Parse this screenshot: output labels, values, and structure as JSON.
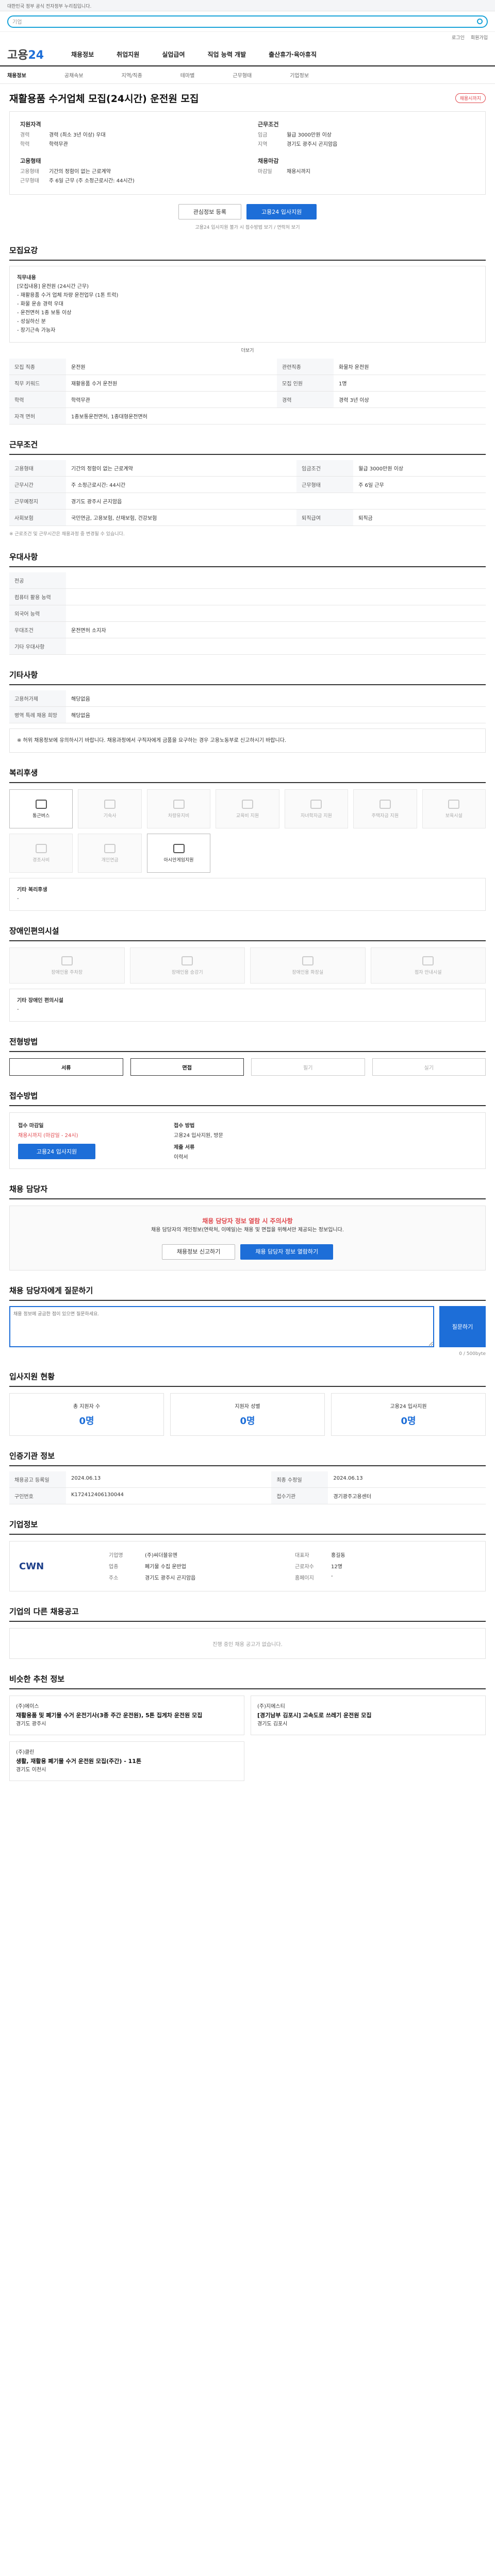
{
  "gov": "대한민국 정부 공식 전자정부 누리집입니다.",
  "search": {
    "placeholder": "기업"
  },
  "links": [
    "로그인",
    "회원가입"
  ],
  "logo": {
    "a": "고용",
    "b": "24"
  },
  "gnb": [
    "채용정보",
    "취업지원",
    "실업급여",
    "직업 능력 개발",
    "출산휴가·육아휴직"
  ],
  "subnav": [
    "채용정보",
    "공채속보",
    "지역/직종",
    "테마별",
    "근무형태",
    "기업정보"
  ],
  "title": "재활용품 수거업체 모집(24시간) 운전원 모집",
  "status": "채용시까지",
  "summary": {
    "h1": "지원자격",
    "r1": [
      [
        "경력",
        "경력 (최소 3년 이상) 우대"
      ],
      [
        "학력",
        "학력무관"
      ]
    ],
    "h2": "근무조건",
    "r2": [
      [
        "임금",
        "월급 3000만원 이상"
      ],
      [
        "지역",
        "경기도 광주시 곤지암읍"
      ]
    ],
    "h3": "고용형태",
    "r3": [
      [
        "고용형태",
        "기간의 정함이 없는 근로계약"
      ],
      [
        "근무형태",
        "주 6일 근무 (주 소정근로시간: 44시간)"
      ]
    ],
    "h4": "채용마감",
    "r4": [
      [
        "마감일",
        "채용시까지"
      ]
    ]
  },
  "buttons": {
    "save": "관심정보 등록",
    "apply": "고용24 입사지원"
  },
  "apply_note": "고용24 입사지원 불가 시 접수방법 보기 / 연락처 보기",
  "detail": {
    "h": "모집요강",
    "job_h": "직무내용",
    "lines": [
      "[모집내용] 운전원 (24시간 근무)",
      "- 재활용품 수거 업체 차량 운전업무 (1톤 트럭)",
      "- 화물 운송 경력 우대",
      "- 운전면허 1종 보통 이상",
      "- 성실하신 분",
      "- 장기근속 가능자"
    ],
    "more": "더보기"
  },
  "recruit": [
    [
      "모집 직종",
      "운전원",
      "관련직종",
      "화물차 운전원"
    ],
    [
      "직무 키워드",
      "재활용품 수거 운전원",
      "모집 인원",
      "1명"
    ],
    [
      "학력",
      "학력무관",
      "경력",
      "경력 3년 이상"
    ],
    [
      "자격 면허",
      "1종보통운전면허, 1종대형운전면허",
      "",
      ""
    ]
  ],
  "cond": {
    "h": "근무조건",
    "rows": [
      [
        "고용형태",
        "기간의 정함이 없는 근로계약",
        "임금조건",
        "월급 3000만원 이상"
      ],
      [
        "근무시간",
        "주 소정근로시간: 44시간",
        "근무형태",
        "주 6일 근무"
      ],
      [
        "근무예정지",
        "경기도 광주시 곤지암읍",
        "",
        ""
      ],
      [
        "사회보험",
        "국민연금, 고용보험, 산재보험, 건강보험",
        "퇴직급여",
        "퇴직금"
      ]
    ],
    "note": "※ 근로조건 및 근무시간은 채용과정 중 변경될 수 있습니다."
  },
  "prefer": {
    "h": "우대사항",
    "rows": [
      [
        "전공",
        ""
      ],
      [
        "컴퓨터 활용 능력",
        ""
      ],
      [
        "외국어 능력",
        ""
      ],
      [
        "우대조건",
        "운전면허 소지자"
      ],
      [
        "기타 우대사항",
        ""
      ]
    ]
  },
  "other": {
    "h": "기타사항",
    "rows": [
      [
        "고용허가제",
        "해당없음"
      ],
      [
        "병역 특례 채용 희망",
        "해당없음"
      ]
    ],
    "notice": "※ 허위 채용정보에 유의하시기 바랍니다. 채용과정에서 구직자에게 금품을 요구하는 경우 고용노동부로 신고하시기 바랍니다."
  },
  "welfare": {
    "h": "복리후생",
    "items": [
      "통근버스",
      "기숙사",
      "차량유지비",
      "교육비 지원",
      "자녀학자금 지원",
      "주택자금 지원",
      "보육시설",
      "경조사비",
      "개인연금",
      "아시안게임지원"
    ],
    "on": [
      0,
      9
    ],
    "etc_h": "기타 복리후생",
    "etc": "-"
  },
  "disabled": {
    "h": "장애인편의시설",
    "items": [
      "장애인용 주차장",
      "장애인용 승강기",
      "장애인용 화장실",
      "점자 안내시설"
    ],
    "etc_h": "기타 장애인 편의시설",
    "etc": "-"
  },
  "process": {
    "h": "전형방법",
    "steps": [
      "서류",
      "면접",
      "필기",
      "실기"
    ],
    "on": [
      0,
      1
    ]
  },
  "applyinfo": {
    "h": "접수방법",
    "rows": [
      [
        "접수 마감일",
        "채용시까지 (마감일 - 24시)"
      ],
      [
        "접수 방법",
        "고용24 입사지원, 방문"
      ],
      [
        "제출 서류",
        "이력서"
      ]
    ],
    "btn": "고용24 입사지원"
  },
  "manager": {
    "h": "채용 담당자",
    "warn": "채용 담당자 정보 열람 시 주의사항",
    "text": "채용 담당자의 개인정보(연락처, 이메일)는 채용 및 면접을 위해서만 제공되는 정보입니다.",
    "btn1": "채용정보 신고하기",
    "btn2": "채용 담당자 정보 열람하기"
  },
  "qa": {
    "h": "채용 담당자에게 질문하기",
    "placeholder": "채용 정보에 궁금한 점이 있으면 질문하세요.",
    "send": "질문하기",
    "count": "0 / 500byte"
  },
  "stats": {
    "h": "입사지원 현황",
    "items": [
      [
        "총 지원자 수",
        "0명"
      ],
      [
        "지원자 성별",
        "0명"
      ],
      [
        "고용24 입사지원",
        "0명"
      ]
    ]
  },
  "reg": {
    "h": "인증기관 정보",
    "rows": [
      [
        "채용공고 등록일",
        "2024.06.13",
        "최종 수정일",
        "2024.06.13"
      ],
      [
        "구인번호",
        "K172412406130044",
        "접수기관",
        "경기광주고용센터"
      ]
    ]
  },
  "company": {
    "h": "기업정보",
    "logo": "CWN",
    "rows": [
      [
        "기업명",
        "(주)씨더블유엔",
        "대표자",
        "홍길동"
      ],
      [
        "업종",
        "폐기물 수집 운반업",
        "근로자수",
        "12명"
      ],
      [
        "주소",
        "경기도 광주시 곤지암읍",
        "홈페이지",
        "-"
      ]
    ]
  },
  "others": {
    "h": "기업의 다른 채용공고",
    "empty": "진행 중인 채용 공고가 없습니다."
  },
  "similar": {
    "h": "비슷한 추천 정보",
    "cards": [
      [
        "(주)에이스",
        "재활용품 및 폐기물 수거 운전기사(3종 주간 운전원), 5톤 집게차 운전원 모집",
        "경기도 광주시"
      ],
      [
        "(주)지에스티",
        "[경기남부 김포시] 고속도로 쓰레기 운전원 모집",
        "경기도 김포시"
      ],
      [
        "(주)클린",
        "생활, 재활용 폐기물 수거 운전원 모집(주간) - 11톤",
        "경기도 이천시"
      ]
    ]
  }
}
